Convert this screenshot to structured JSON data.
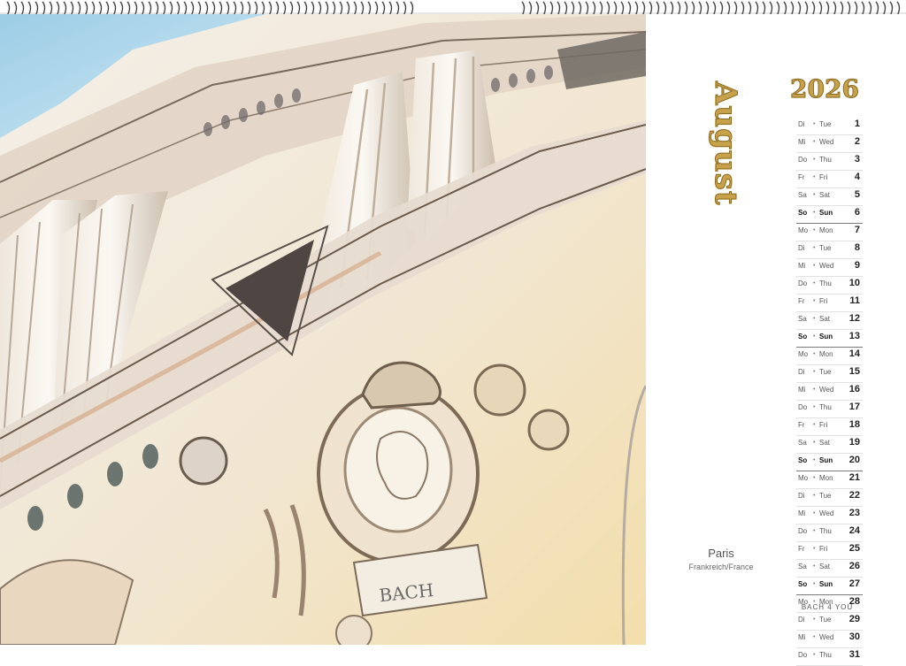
{
  "calendar": {
    "month": "August",
    "year": "2026",
    "location": {
      "city": "Paris",
      "country": "Frankreich/France"
    },
    "brand": "BACH 4 YOU",
    "painting_label": "BACH",
    "days": [
      {
        "de": "Di",
        "en": "Tue",
        "num": "1"
      },
      {
        "de": "Mi",
        "en": "Wed",
        "num": "2"
      },
      {
        "de": "Do",
        "en": "Thu",
        "num": "3"
      },
      {
        "de": "Fr",
        "en": "Fri",
        "num": "4"
      },
      {
        "de": "Sa",
        "en": "Sat",
        "num": "5"
      },
      {
        "de": "So",
        "en": "Sun",
        "num": "6"
      },
      {
        "de": "Mo",
        "en": "Mon",
        "num": "7"
      },
      {
        "de": "Di",
        "en": "Tue",
        "num": "8"
      },
      {
        "de": "Mi",
        "en": "Wed",
        "num": "9"
      },
      {
        "de": "Do",
        "en": "Thu",
        "num": "10"
      },
      {
        "de": "Fr",
        "en": "Fri",
        "num": "11"
      },
      {
        "de": "Sa",
        "en": "Sat",
        "num": "12"
      },
      {
        "de": "So",
        "en": "Sun",
        "num": "13"
      },
      {
        "de": "Mo",
        "en": "Mon",
        "num": "14"
      },
      {
        "de": "Di",
        "en": "Tue",
        "num": "15"
      },
      {
        "de": "Mi",
        "en": "Wed",
        "num": "16"
      },
      {
        "de": "Do",
        "en": "Thu",
        "num": "17"
      },
      {
        "de": "Fr",
        "en": "Fri",
        "num": "18"
      },
      {
        "de": "Sa",
        "en": "Sat",
        "num": "19"
      },
      {
        "de": "So",
        "en": "Sun",
        "num": "20"
      },
      {
        "de": "Mo",
        "en": "Mon",
        "num": "21"
      },
      {
        "de": "Di",
        "en": "Tue",
        "num": "22"
      },
      {
        "de": "Mi",
        "en": "Wed",
        "num": "23"
      },
      {
        "de": "Do",
        "en": "Thu",
        "num": "24"
      },
      {
        "de": "Fr",
        "en": "Fri",
        "num": "25"
      },
      {
        "de": "Sa",
        "en": "Sat",
        "num": "26"
      },
      {
        "de": "So",
        "en": "Sun",
        "num": "27"
      },
      {
        "de": "Mo",
        "en": "Mon",
        "num": "28"
      },
      {
        "de": "Di",
        "en": "Tue",
        "num": "29"
      },
      {
        "de": "Mi",
        "en": "Wed",
        "num": "30"
      },
      {
        "de": "Do",
        "en": "Thu",
        "num": "31"
      }
    ]
  },
  "colors": {
    "gold": "#c8a24a",
    "sky": "#a8d4ea",
    "stone": "#d9cdbf",
    "ochre": "#f0dfa8"
  }
}
